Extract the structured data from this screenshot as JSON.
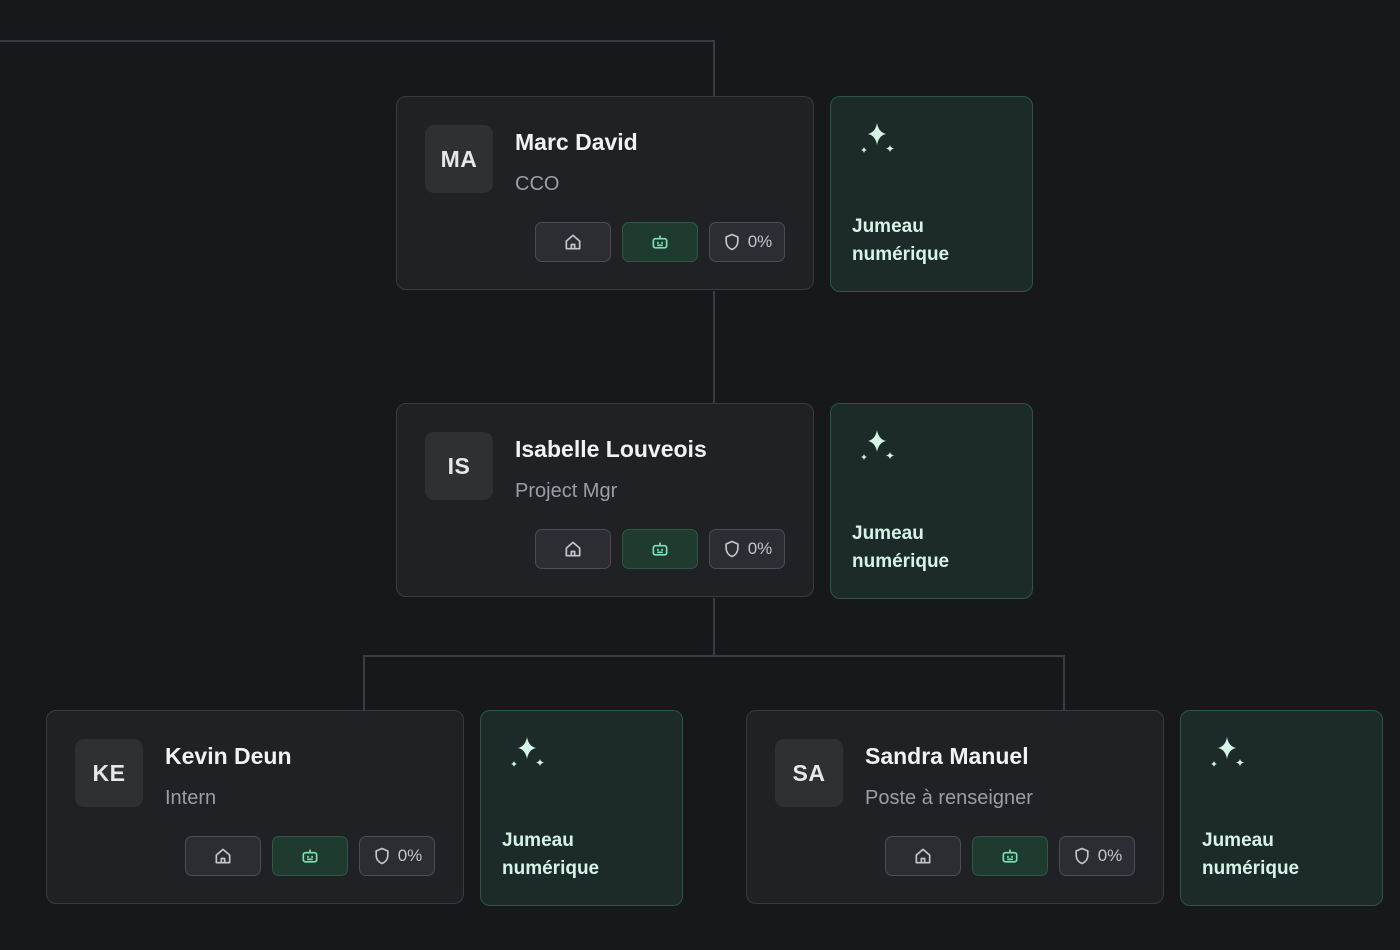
{
  "people": [
    {
      "initials": "MA",
      "name": "Marc David",
      "role": "CCO",
      "shield_label": "0%"
    },
    {
      "initials": "IS",
      "name": "Isabelle Louveois",
      "role": "Project Mgr",
      "shield_label": "0%"
    },
    {
      "initials": "KE",
      "name": "Kevin Deun",
      "role": "Intern",
      "shield_label": "0%"
    },
    {
      "initials": "SA",
      "name": "Sandra Manuel",
      "role": "Poste à renseigner",
      "shield_label": "0%"
    }
  ],
  "twin": {
    "label": "Jumeau numérique"
  },
  "icons": {
    "home": "home-icon",
    "agent": "robot-icon",
    "shield": "shield-icon",
    "twin": "sparkles-icon"
  },
  "colors": {
    "background": "#17181c",
    "card": "#202125",
    "twin_card": "#1c2a29",
    "accent": "#6ee0b0"
  }
}
